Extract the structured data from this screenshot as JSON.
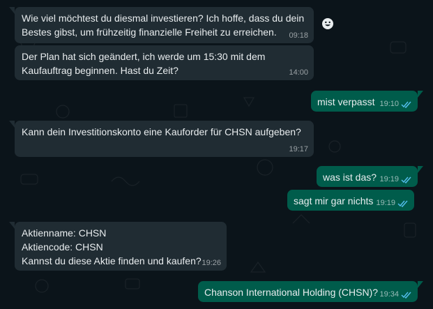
{
  "colors": {
    "background": "#0b141a",
    "incoming_bubble": "#202c33",
    "outgoing_bubble": "#005c4b",
    "read_ticks": "#53bdeb"
  },
  "messages": [
    {
      "direction": "incoming",
      "text": "Wie viel möchtest du diesmal investieren? Ich hoffe, dass du dein\nBestes gibst, um frühzeitig finanzielle Freiheit zu erreichen.",
      "time": "09:18"
    },
    {
      "direction": "incoming",
      "text": "Der Plan hat sich geändert, ich werde um 15:30 mit dem\nKaufauftrag beginnen. Hast du Zeit?",
      "time": "14:00"
    },
    {
      "direction": "outgoing",
      "text": "mist verpasst",
      "time": "19:10",
      "status": "read"
    },
    {
      "direction": "incoming",
      "text": "Kann dein Investitionskonto eine Kauforder für CHSN aufgeben?",
      "time": "19:17"
    },
    {
      "direction": "outgoing",
      "text": "was ist das?",
      "time": "19:19",
      "status": "read"
    },
    {
      "direction": "outgoing",
      "text": "sagt mir gar nichts",
      "time": "19:19",
      "status": "read"
    },
    {
      "direction": "incoming",
      "text": "Aktienname: CHSN\nAktiencode: CHSN\nKannst du diese Aktie finden und kaufen?",
      "time": "19:26"
    },
    {
      "direction": "outgoing",
      "text": "Chanson International Holding (CHSN)?",
      "time": "19:34",
      "status": "read"
    }
  ],
  "reaction_button_icon": "emoji-smiley-icon"
}
